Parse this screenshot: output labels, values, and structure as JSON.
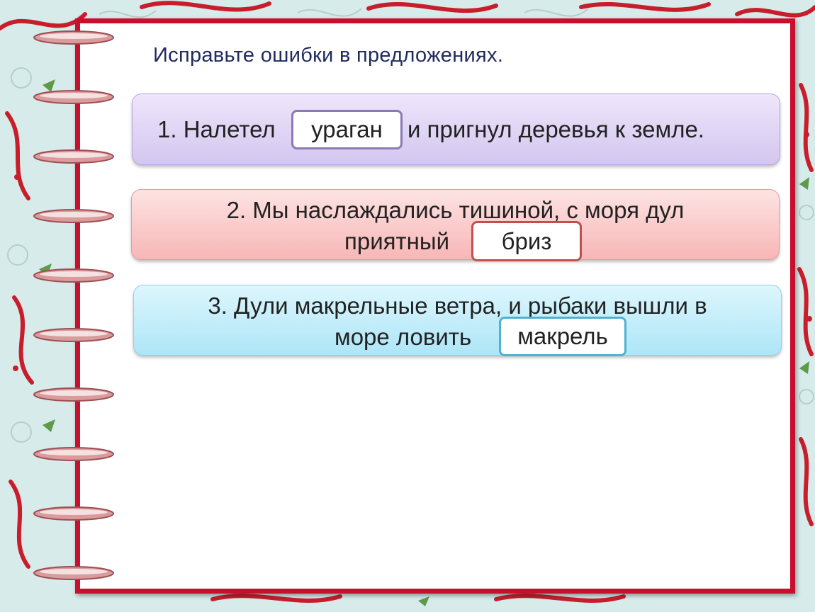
{
  "heading": "Исправьте ошибки в предложениях.",
  "sentences": [
    {
      "before": "1. Налетел",
      "after": "и пригнул деревья к земле.",
      "answer": "ураган",
      "border_color": "#8a7bb7"
    },
    {
      "line1": "2. Мы наслаждались тишиной, с моря дул",
      "line2_before": "приятный",
      "answer": "бриз",
      "border_color": "#c0504d"
    },
    {
      "line1": "3. Дули макрельные ветра, и рыбаки вышли в",
      "line2_before": "море ловить",
      "answer": "макрель",
      "border_color": "#4fb2cf"
    }
  ],
  "colors": {
    "frame": "#c8102e",
    "card_1": "#d3c6ef",
    "card_2": "#f8b6b6",
    "card_3": "#ade6f7"
  }
}
